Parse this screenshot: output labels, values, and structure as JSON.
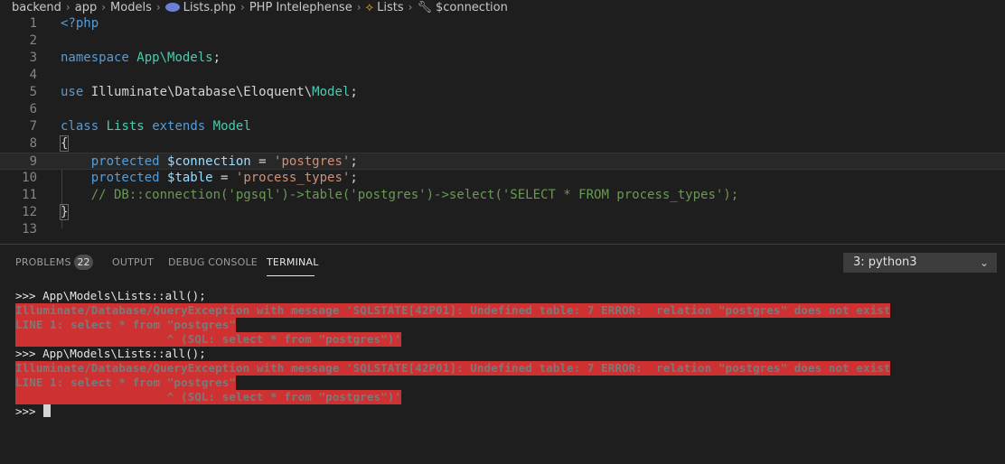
{
  "breadcrumb": {
    "items": [
      "backend",
      "app",
      "Models",
      "Lists.php",
      "PHP Intelephense",
      "Lists",
      "$connection"
    ]
  },
  "editor": {
    "lines": [
      {
        "num": "1"
      },
      {
        "num": "2"
      },
      {
        "num": "3"
      },
      {
        "num": "4"
      },
      {
        "num": "5"
      },
      {
        "num": "6"
      },
      {
        "num": "7"
      },
      {
        "num": "8"
      },
      {
        "num": "9"
      },
      {
        "num": "10"
      },
      {
        "num": "11"
      },
      {
        "num": "12"
      },
      {
        "num": "13"
      }
    ],
    "tokens": {
      "php_open": "<?php",
      "namespace_kw": "namespace",
      "namespace_name": "App\\Models",
      "semicolon": ";",
      "use_kw": "use",
      "use_path": "Illuminate\\Database\\Eloquent\\",
      "use_class": "Model",
      "class_kw": "class",
      "class_name": "Lists",
      "extends_kw": "extends",
      "parent_class": "Model",
      "open_brace": "{",
      "close_brace": "}",
      "protected_kw": "protected",
      "conn_var": "$connection",
      "equals": " = ",
      "conn_val": "'postgres'",
      "table_var": "$table",
      "table_val": "'process_types'",
      "comment": "// DB::connection('pgsql')->table('postgres')->select('SELECT * FROM process_types');"
    }
  },
  "panel": {
    "tabs": {
      "problems": "PROBLEMS",
      "problems_count": "22",
      "output": "OUTPUT",
      "debug_console": "DEBUG CONSOLE",
      "terminal": "TERMINAL"
    },
    "terminal_select": "3: python3",
    "terminal_lines": [
      {
        "kind": "prompt",
        "text": ">>> App\\Models\\Lists::all();"
      },
      {
        "kind": "error",
        "text": "Illuminate/Database/QueryException with message 'SQLSTATE[42P01]: Undefined table: 7 ERROR:  relation \"postgres\" does not exist"
      },
      {
        "kind": "error",
        "text": "LINE 1: select * from \"postgres\""
      },
      {
        "kind": "error",
        "text": "                      ^ (SQL: select * from \"postgres\")'"
      },
      {
        "kind": "prompt",
        "text": ">>> App\\Models\\Lists::all();"
      },
      {
        "kind": "error",
        "text": "Illuminate/Database/QueryException with message 'SQLSTATE[42P01]: Undefined table: 7 ERROR:  relation \"postgres\" does not exist"
      },
      {
        "kind": "error",
        "text": "LINE 1: select * from \"postgres\""
      },
      {
        "kind": "error",
        "text": "                      ^ (SQL: select * from \"postgres\")'"
      },
      {
        "kind": "prompt",
        "text": ">>> "
      }
    ]
  },
  "colors": {
    "background": "#1e1e1e",
    "keyword": "#569cd6",
    "class": "#4ec9b0",
    "variable": "#9cdcfe",
    "string": "#ce9178",
    "comment": "#6a9955",
    "error_bg": "#cd3131"
  }
}
